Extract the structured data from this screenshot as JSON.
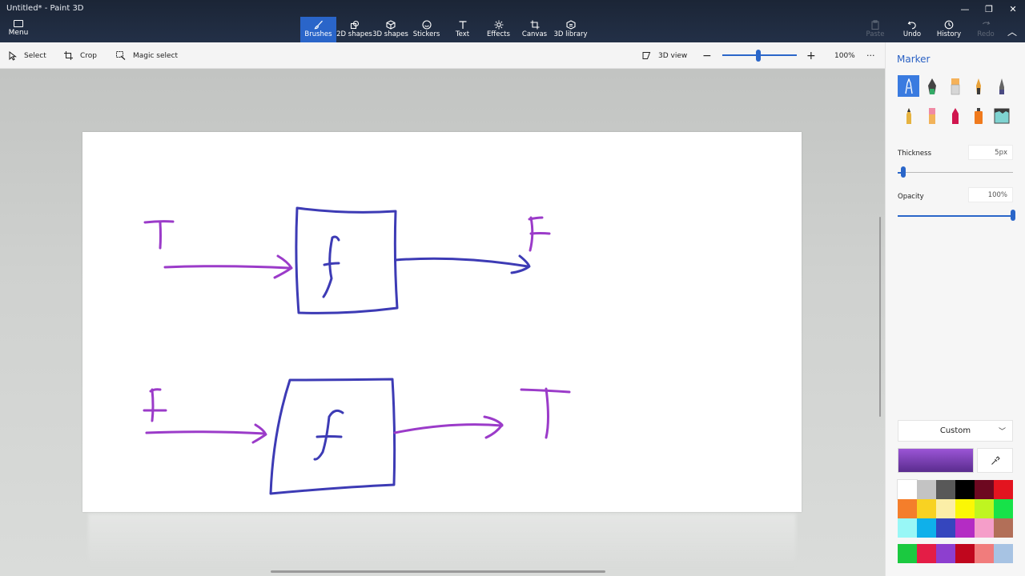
{
  "window": {
    "title": "Untitled* - Paint 3D"
  },
  "menu": {
    "label": "Menu"
  },
  "tools": [
    {
      "label": "Brushes",
      "icon": "brush-icon"
    },
    {
      "label": "2D shapes",
      "icon": "2d-shapes-icon"
    },
    {
      "label": "3D shapes",
      "icon": "3d-shapes-icon"
    },
    {
      "label": "Stickers",
      "icon": "stickers-icon"
    },
    {
      "label": "Text",
      "icon": "text-icon"
    },
    {
      "label": "Effects",
      "icon": "effects-icon"
    },
    {
      "label": "Canvas",
      "icon": "canvas-icon"
    },
    {
      "label": "3D library",
      "icon": "3d-library-icon"
    }
  ],
  "actions": {
    "paste": "Paste",
    "undo": "Undo",
    "history": "History",
    "redo": "Redo"
  },
  "subbar": {
    "select": "Select",
    "crop": "Crop",
    "magic_select": "Magic select",
    "view_3d": "3D view",
    "zoom_minus": "−",
    "zoom_plus": "+",
    "zoom_value": "100%",
    "more": "···"
  },
  "panel": {
    "title": "Marker",
    "thickness_label": "Thickness",
    "thickness_value": "5px",
    "opacity_label": "Opacity",
    "opacity_value": "100%",
    "thickness_level": 0.05,
    "opacity_level": 1.0,
    "color_mode": "Custom",
    "brushes": [
      "marker",
      "calligraphy-pen",
      "oil-brush",
      "watercolor",
      "pixel-pen",
      "pencil",
      "eraser",
      "crayon",
      "spray-can",
      "fill"
    ],
    "current_color": [
      "#9b55d6",
      "#5a2c8e"
    ],
    "palette": [
      "#ffffff",
      "#c3c3c3",
      "#585858",
      "#000000",
      "#6d0820",
      "#e3141f",
      "#f47e2b",
      "#f8d222",
      "#fbeea7",
      "#fbf705",
      "#bff520",
      "#17e249",
      "#98f7f6",
      "#0fb0ea",
      "#3546be",
      "#b42cc4",
      "#f59ec9",
      "#b26f58"
    ],
    "custom_colors": [
      "#1bc940",
      "#e41d46",
      "#8d3fcf",
      "#c0061d",
      "#f17c7c",
      "#a7c3e3"
    ]
  },
  "drawing": {
    "colors": {
      "blue": "#3d3bb5",
      "purple": "#9b3bc9"
    }
  }
}
